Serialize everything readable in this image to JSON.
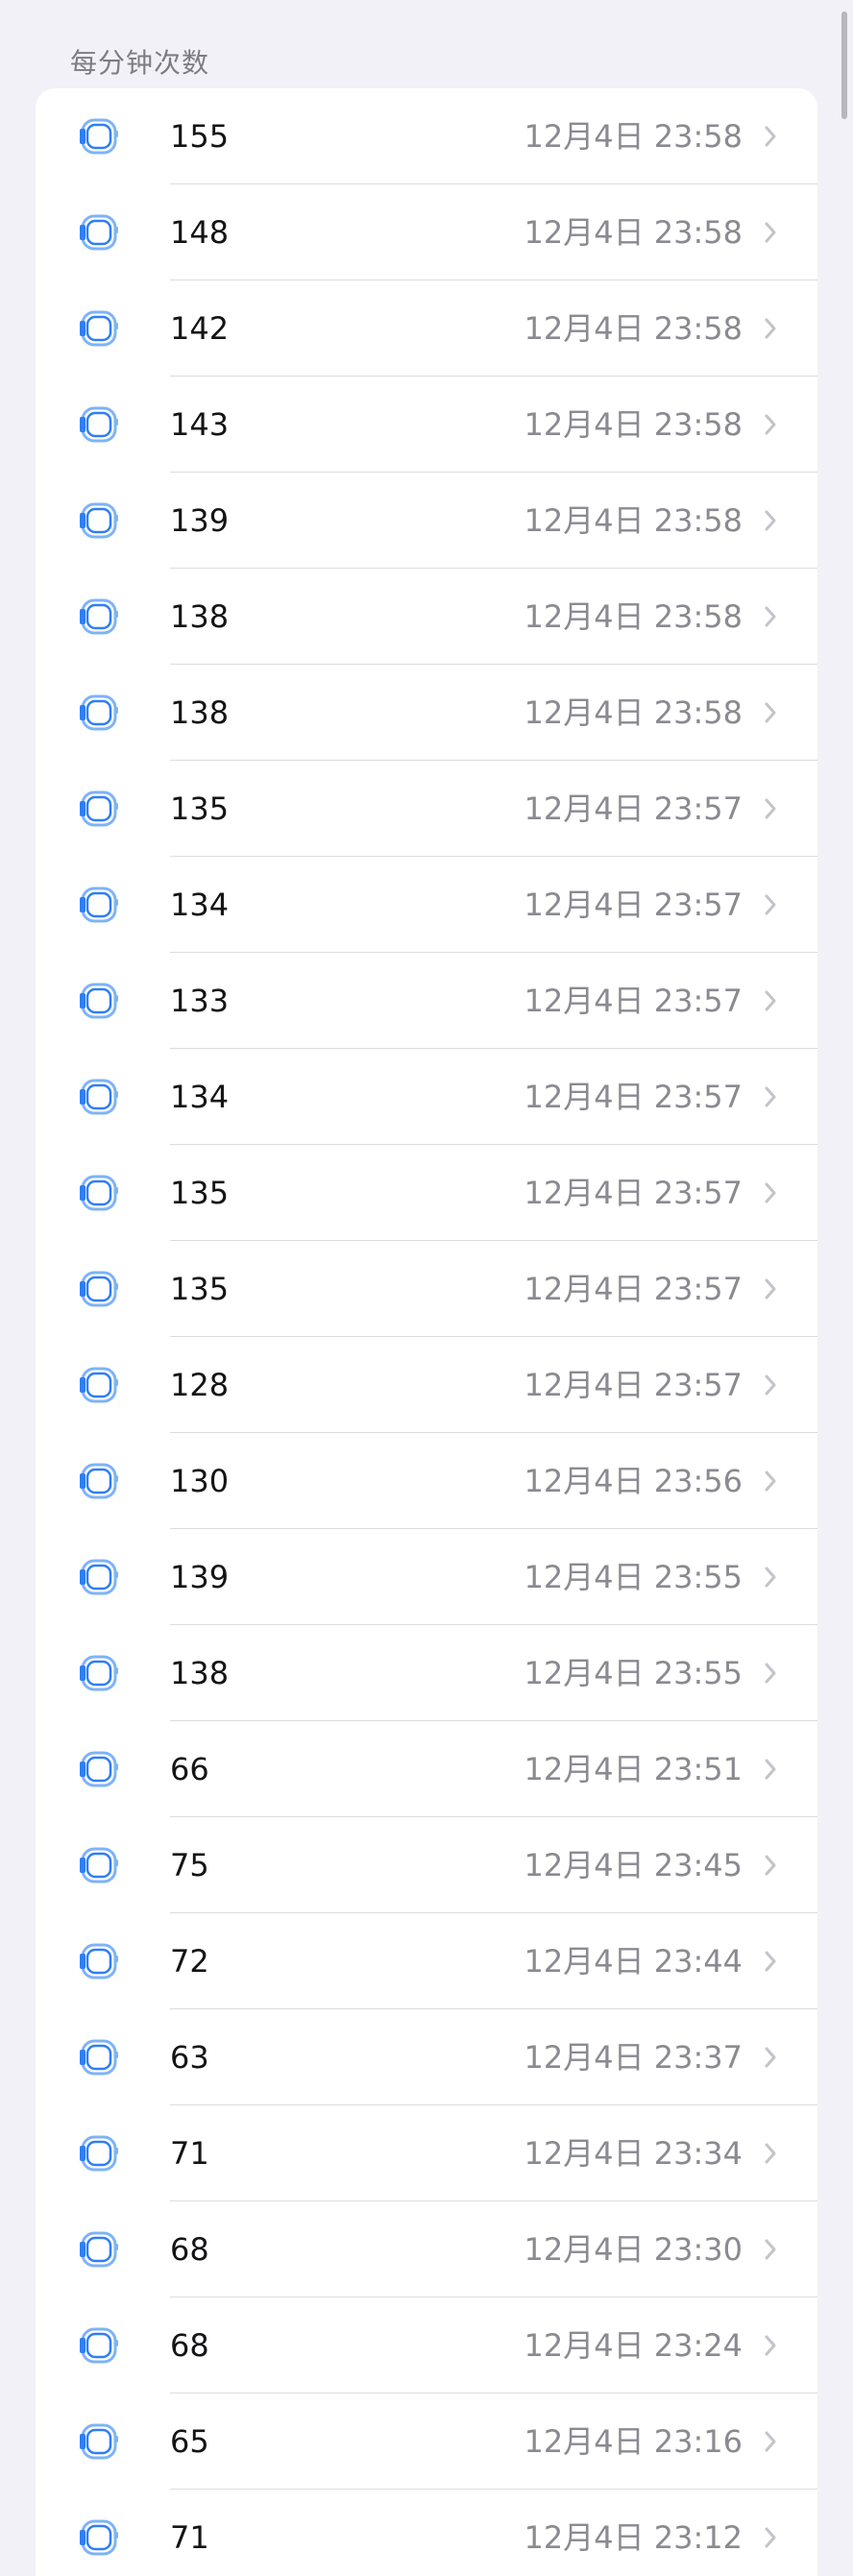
{
  "section_header": "每分钟次数",
  "colors": {
    "background": "#f2f1f7",
    "card": "#ffffff",
    "value_text": "#141416",
    "secondary_text": "#8a8a90",
    "watch_icon_blue": "#2f7ff5",
    "chevron": "#c4c4c8",
    "divider": "#dcdce0"
  },
  "row_icon": "apple-watch-icon",
  "rows": [
    {
      "value": "155",
      "time": "12月4日 23:58"
    },
    {
      "value": "148",
      "time": "12月4日 23:58"
    },
    {
      "value": "142",
      "time": "12月4日 23:58"
    },
    {
      "value": "143",
      "time": "12月4日 23:58"
    },
    {
      "value": "139",
      "time": "12月4日 23:58"
    },
    {
      "value": "138",
      "time": "12月4日 23:58"
    },
    {
      "value": "138",
      "time": "12月4日 23:58"
    },
    {
      "value": "135",
      "time": "12月4日 23:57"
    },
    {
      "value": "134",
      "time": "12月4日 23:57"
    },
    {
      "value": "133",
      "time": "12月4日 23:57"
    },
    {
      "value": "134",
      "time": "12月4日 23:57"
    },
    {
      "value": "135",
      "time": "12月4日 23:57"
    },
    {
      "value": "135",
      "time": "12月4日 23:57"
    },
    {
      "value": "128",
      "time": "12月4日 23:57"
    },
    {
      "value": "130",
      "time": "12月4日 23:56"
    },
    {
      "value": "139",
      "time": "12月4日 23:55"
    },
    {
      "value": "138",
      "time": "12月4日 23:55"
    },
    {
      "value": "66",
      "time": "12月4日 23:51"
    },
    {
      "value": "75",
      "time": "12月4日 23:45"
    },
    {
      "value": "72",
      "time": "12月4日 23:44"
    },
    {
      "value": "63",
      "time": "12月4日 23:37"
    },
    {
      "value": "71",
      "time": "12月4日 23:34"
    },
    {
      "value": "68",
      "time": "12月4日 23:30"
    },
    {
      "value": "68",
      "time": "12月4日 23:24"
    },
    {
      "value": "65",
      "time": "12月4日 23:16"
    },
    {
      "value": "71",
      "time": "12月4日 23:12"
    }
  ]
}
